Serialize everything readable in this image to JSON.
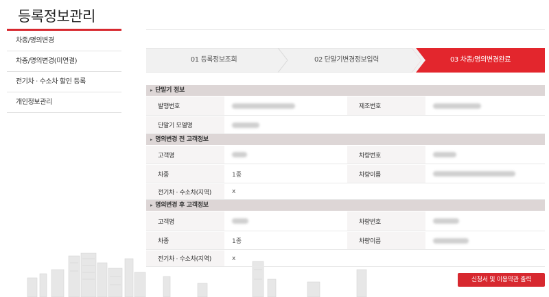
{
  "sidebar": {
    "title": "등록정보관리",
    "items": [
      {
        "label": "차종/명의변경"
      },
      {
        "label": "차종/명의변경(미연결)"
      },
      {
        "label": "전기차 · 수소차 할인 등록"
      },
      {
        "label": "개인정보관리"
      }
    ]
  },
  "steps": [
    {
      "label": "01 등록정보조회"
    },
    {
      "label": "02 단말기변경정보입력"
    },
    {
      "label": "03 차종/명의변경완료"
    }
  ],
  "sections": {
    "terminal": {
      "title": "단말기 정보",
      "issue_no_label": "발행번호",
      "serial_label": "제조번호",
      "model_label": "단말기 모델명"
    },
    "before": {
      "title": "명의변경 전 고객정보",
      "customer_label": "고객명",
      "plate_label": "차량번호",
      "type_label": "차종",
      "type_value": "1종",
      "vehicle_name_label": "차량이름",
      "ev_label": "전기차 · 수소차(지역)",
      "ev_value": "x"
    },
    "after": {
      "title": "명의변경 후 고객정보",
      "customer_label": "고객명",
      "plate_label": "차량번호",
      "type_label": "차종",
      "type_value": "1종",
      "vehicle_name_label": "차량이름",
      "ev_label": "전기차 · 수소차(지역)",
      "ev_value": "x"
    }
  },
  "actions": {
    "print_label": "신청서 및 이용약관 출력"
  },
  "colors": {
    "accent": "#d7282f",
    "section_bg": "#ddd6d6",
    "label_bg": "#f6f4f4"
  }
}
